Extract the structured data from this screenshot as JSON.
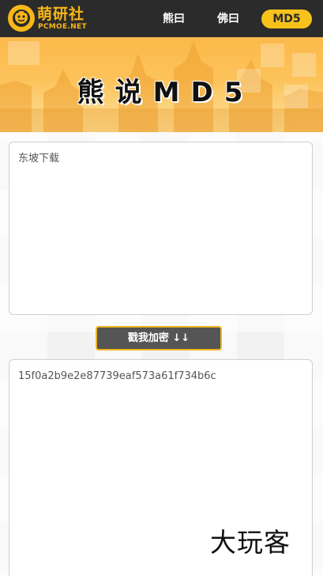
{
  "logo": {
    "cn_text": "萌研社",
    "en_text": "PCMOE.NET",
    "icon": "mascot-icon",
    "color": "#f7b718"
  },
  "nav": {
    "items": [
      {
        "label": "熊曰",
        "active": false
      },
      {
        "label": "佛曰",
        "active": false
      },
      {
        "label": "MD5",
        "active": true
      }
    ]
  },
  "banner": {
    "title": "熊说MD5"
  },
  "input": {
    "value": "东坡下载"
  },
  "encrypt_button": {
    "label": "戳我加密 ↓↓"
  },
  "output": {
    "value": "15f0a2b9e2e87739eaf573a61f734b6c"
  },
  "watermark": {
    "text": "大玩客"
  },
  "colors": {
    "navbar_bg": "#2b2b2b",
    "accent_yellow": "#f7c21a",
    "button_bg": "#555555",
    "button_border": "#f0b51f"
  }
}
